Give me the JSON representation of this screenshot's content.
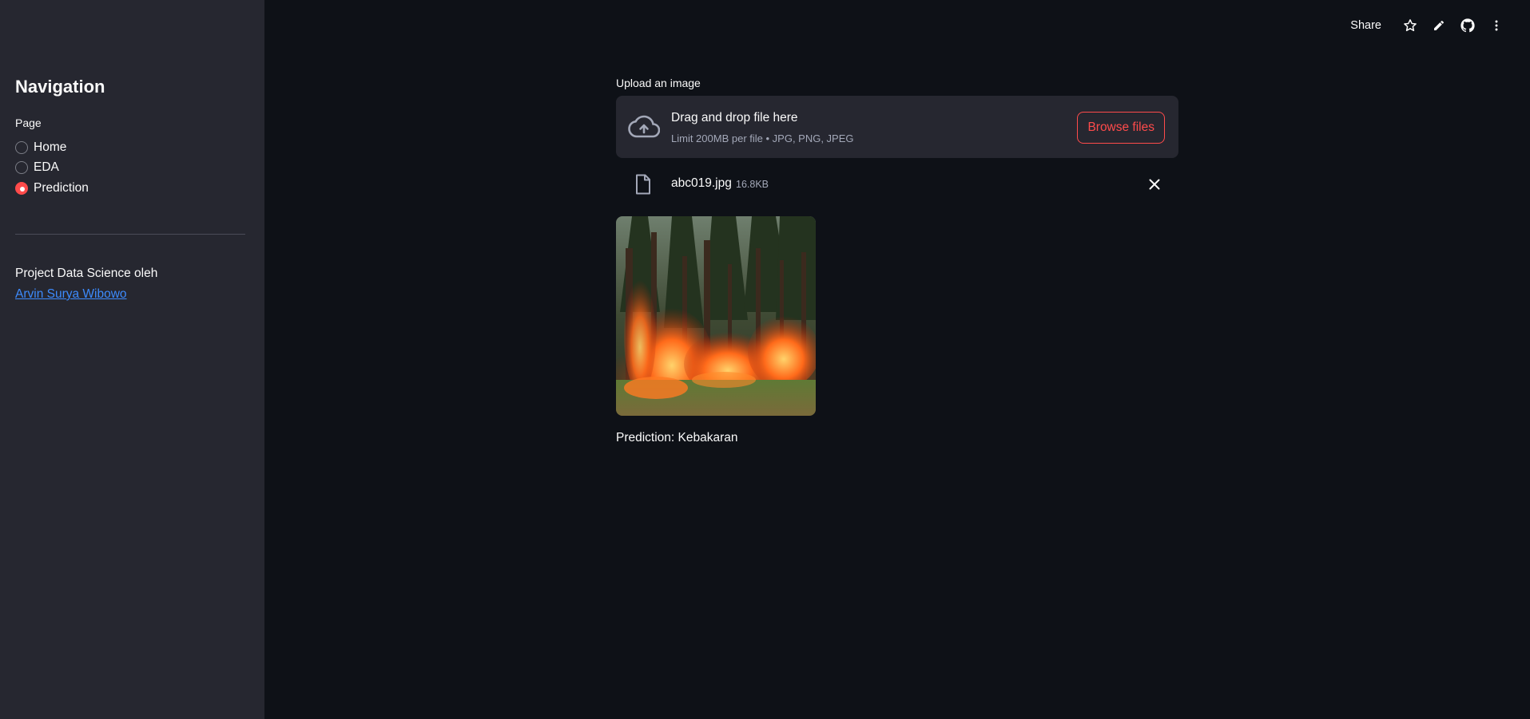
{
  "sidebar": {
    "title": "Navigation",
    "radio_label": "Page",
    "options": [
      {
        "label": "Home",
        "selected": false
      },
      {
        "label": "EDA",
        "selected": false
      },
      {
        "label": "Prediction",
        "selected": true
      }
    ],
    "credit_text": "Project Data Science oleh",
    "credit_link": "Arvin Surya Wibowo"
  },
  "toolbar": {
    "share_label": "Share",
    "icons": [
      "star-icon",
      "pencil-icon",
      "github-icon",
      "more-vertical-icon"
    ]
  },
  "uploader": {
    "label": "Upload an image",
    "drop_title": "Drag and drop file here",
    "drop_subtitle": "Limit 200MB per file • JPG, PNG, JPEG",
    "browse_label": "Browse files"
  },
  "file": {
    "name": "abc019.jpg",
    "size": "16.8KB"
  },
  "image": {
    "subject": "forest-fire-photo"
  },
  "result": {
    "prediction_text": "Prediction: Kebakaran"
  },
  "colors": {
    "background": "#0e1117",
    "sidebar": "#262730",
    "accent": "#ff4b4b",
    "link": "#3d8bfd"
  }
}
